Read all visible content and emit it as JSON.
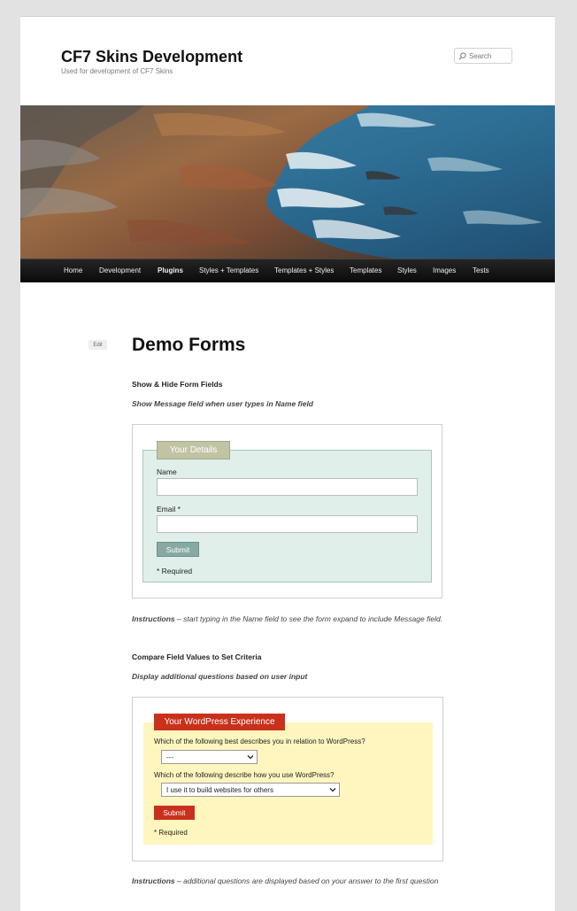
{
  "site": {
    "title": "CF7 Skins Development",
    "description": "Used for development of CF7 Skins"
  },
  "search": {
    "placeholder": "Search"
  },
  "nav": {
    "items": [
      "Home",
      "Development",
      "Plugins",
      "Styles + Templates",
      "Templates + Styles",
      "Templates",
      "Styles",
      "Images",
      "Tests"
    ],
    "active": "Plugins"
  },
  "page": {
    "edit_label": "Edit",
    "title": "Demo Forms"
  },
  "section1": {
    "title": "Show & Hide Form Fields",
    "subtitle": "Show Message field when user types in Name field",
    "form": {
      "legend": "Your Details",
      "name_label": "Name",
      "name_value": "",
      "email_label": "Email *",
      "email_value": "",
      "submit_label": "Submit",
      "required_note": "* Required"
    },
    "instructions_lead": "Instructions",
    "instructions_text": " – start typing in the Name field to see the form expand to include Message field."
  },
  "section2": {
    "title": "Compare Field Values to Set Criteria",
    "subtitle": "Display additional questions based on user input",
    "form": {
      "legend": "Your WordPress Experience",
      "q1_label": "Which of the following best describes you in relation to WordPress?",
      "q1_selected": "---",
      "q2_label": "Which of the following describe how you use WordPress?",
      "q2_selected": "I use it to build websites for others",
      "submit_label": "Submit",
      "required_note": "* Required"
    },
    "instructions_lead": "Instructions",
    "instructions_text": " – additional questions are displayed based on your answer to the first question"
  },
  "colors": {
    "form1_fieldset_bg": "#e0efe9",
    "form1_legend_bg": "#c2c3a4",
    "form1_button_bg": "#86a9a4",
    "form2_fieldset_bg": "#fff6bf",
    "form2_accent": "#c9311c",
    "nav_bg": "#111111"
  }
}
